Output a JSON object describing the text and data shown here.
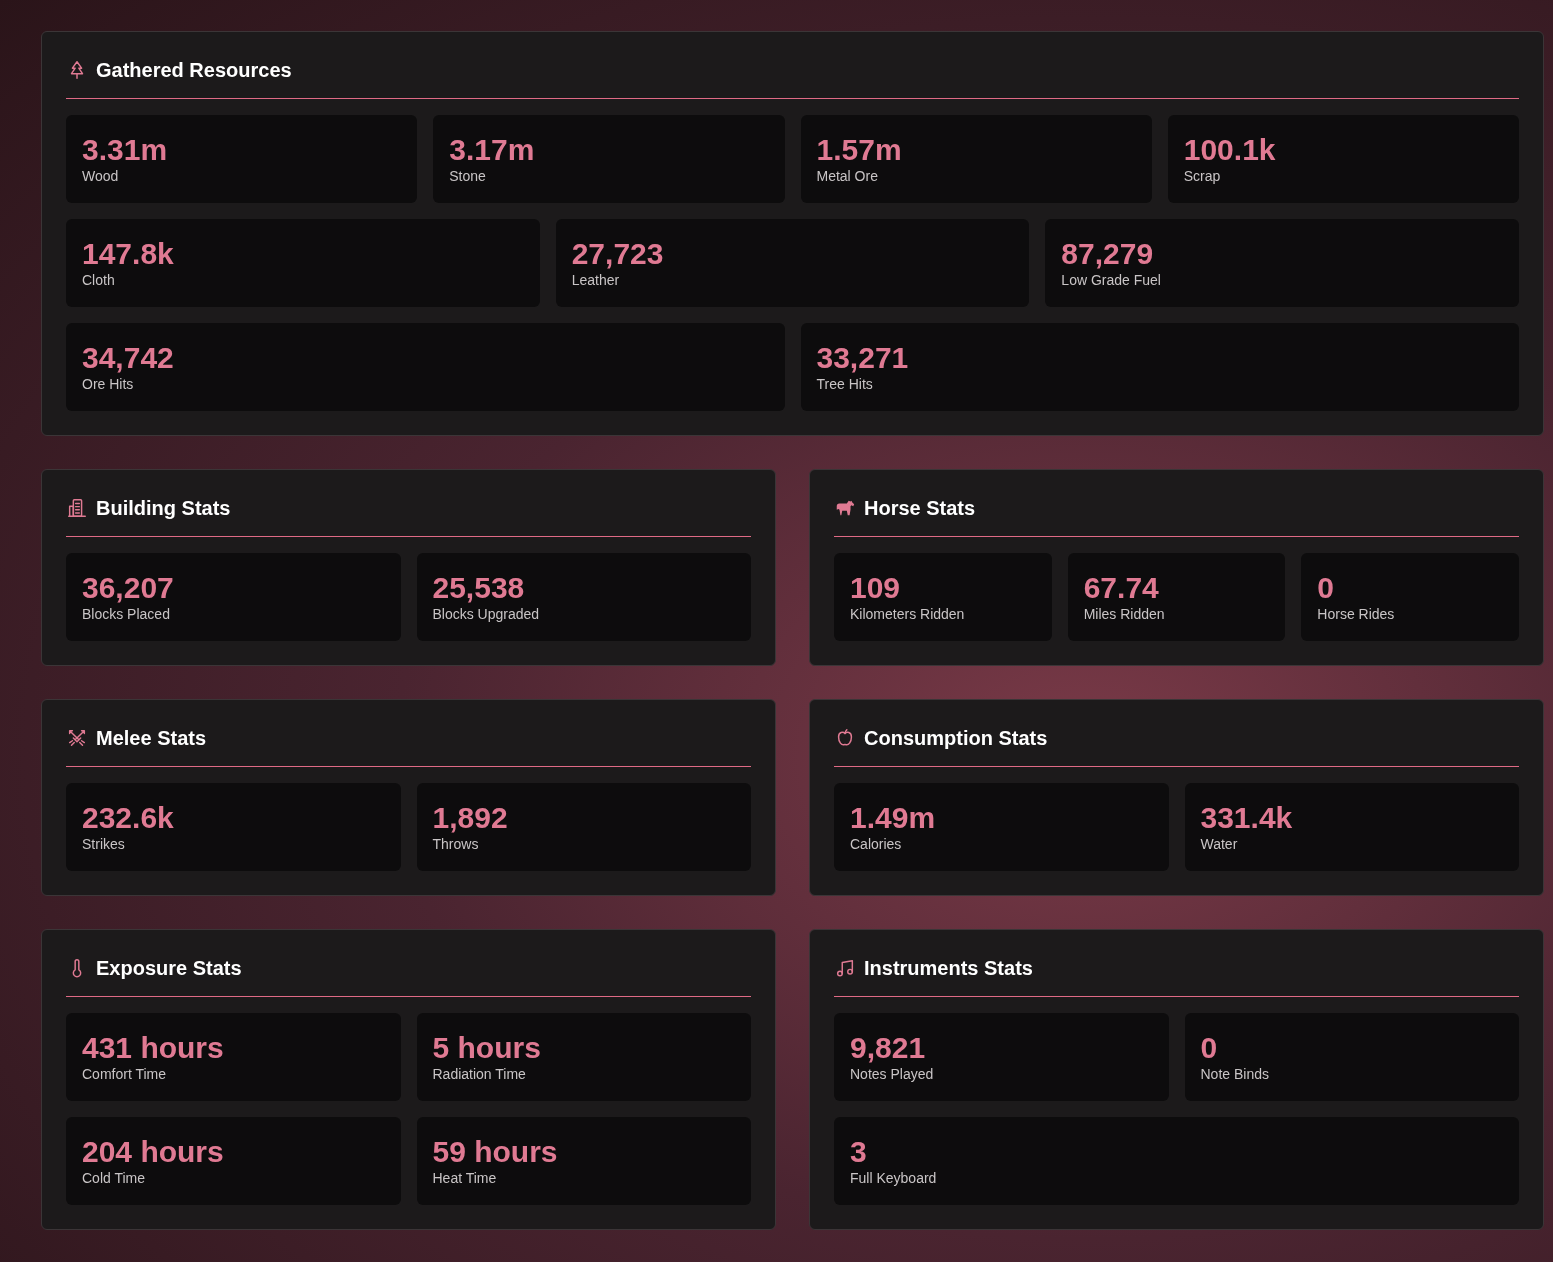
{
  "panels": [
    {
      "title": "Gathered Resources",
      "rows": [
        [
          {
            "value": "3.31m",
            "label": "Wood"
          },
          {
            "value": "3.17m",
            "label": "Stone"
          },
          {
            "value": "1.57m",
            "label": "Metal Ore"
          },
          {
            "value": "100.1k",
            "label": "Scrap"
          }
        ],
        [
          {
            "value": "147.8k",
            "label": "Cloth"
          },
          {
            "value": "27,723",
            "label": "Leather"
          },
          {
            "value": "87,279",
            "label": "Low Grade Fuel"
          }
        ],
        [
          {
            "value": "34,742",
            "label": "Ore Hits"
          },
          {
            "value": "33,271",
            "label": "Tree Hits"
          }
        ]
      ]
    },
    {
      "title": "Building Stats",
      "rows": [
        [
          {
            "value": "36,207",
            "label": "Blocks Placed"
          },
          {
            "value": "25,538",
            "label": "Blocks Upgraded"
          }
        ]
      ]
    },
    {
      "title": "Horse Stats",
      "rows": [
        [
          {
            "value": "109",
            "label": "Kilometers Ridden"
          },
          {
            "value": "67.74",
            "label": "Miles Ridden"
          },
          {
            "value": "0",
            "label": "Horse Rides"
          }
        ]
      ]
    },
    {
      "title": "Melee Stats",
      "rows": [
        [
          {
            "value": "232.6k",
            "label": "Strikes"
          },
          {
            "value": "1,892",
            "label": "Throws"
          }
        ]
      ]
    },
    {
      "title": "Consumption Stats",
      "rows": [
        [
          {
            "value": "1.49m",
            "label": "Calories"
          },
          {
            "value": "331.4k",
            "label": "Water"
          }
        ]
      ]
    },
    {
      "title": "Exposure Stats",
      "rows": [
        [
          {
            "value": "431 hours",
            "label": "Comfort Time"
          },
          {
            "value": "5 hours",
            "label": "Radiation Time"
          }
        ],
        [
          {
            "value": "204 hours",
            "label": "Cold Time"
          },
          {
            "value": "59 hours",
            "label": "Heat Time"
          }
        ]
      ]
    },
    {
      "title": "Instruments Stats",
      "rows": [
        [
          {
            "value": "9,821",
            "label": "Notes Played"
          },
          {
            "value": "0",
            "label": "Note Binds"
          }
        ],
        [
          {
            "value": "3",
            "label": "Full Keyboard"
          }
        ]
      ]
    }
  ]
}
